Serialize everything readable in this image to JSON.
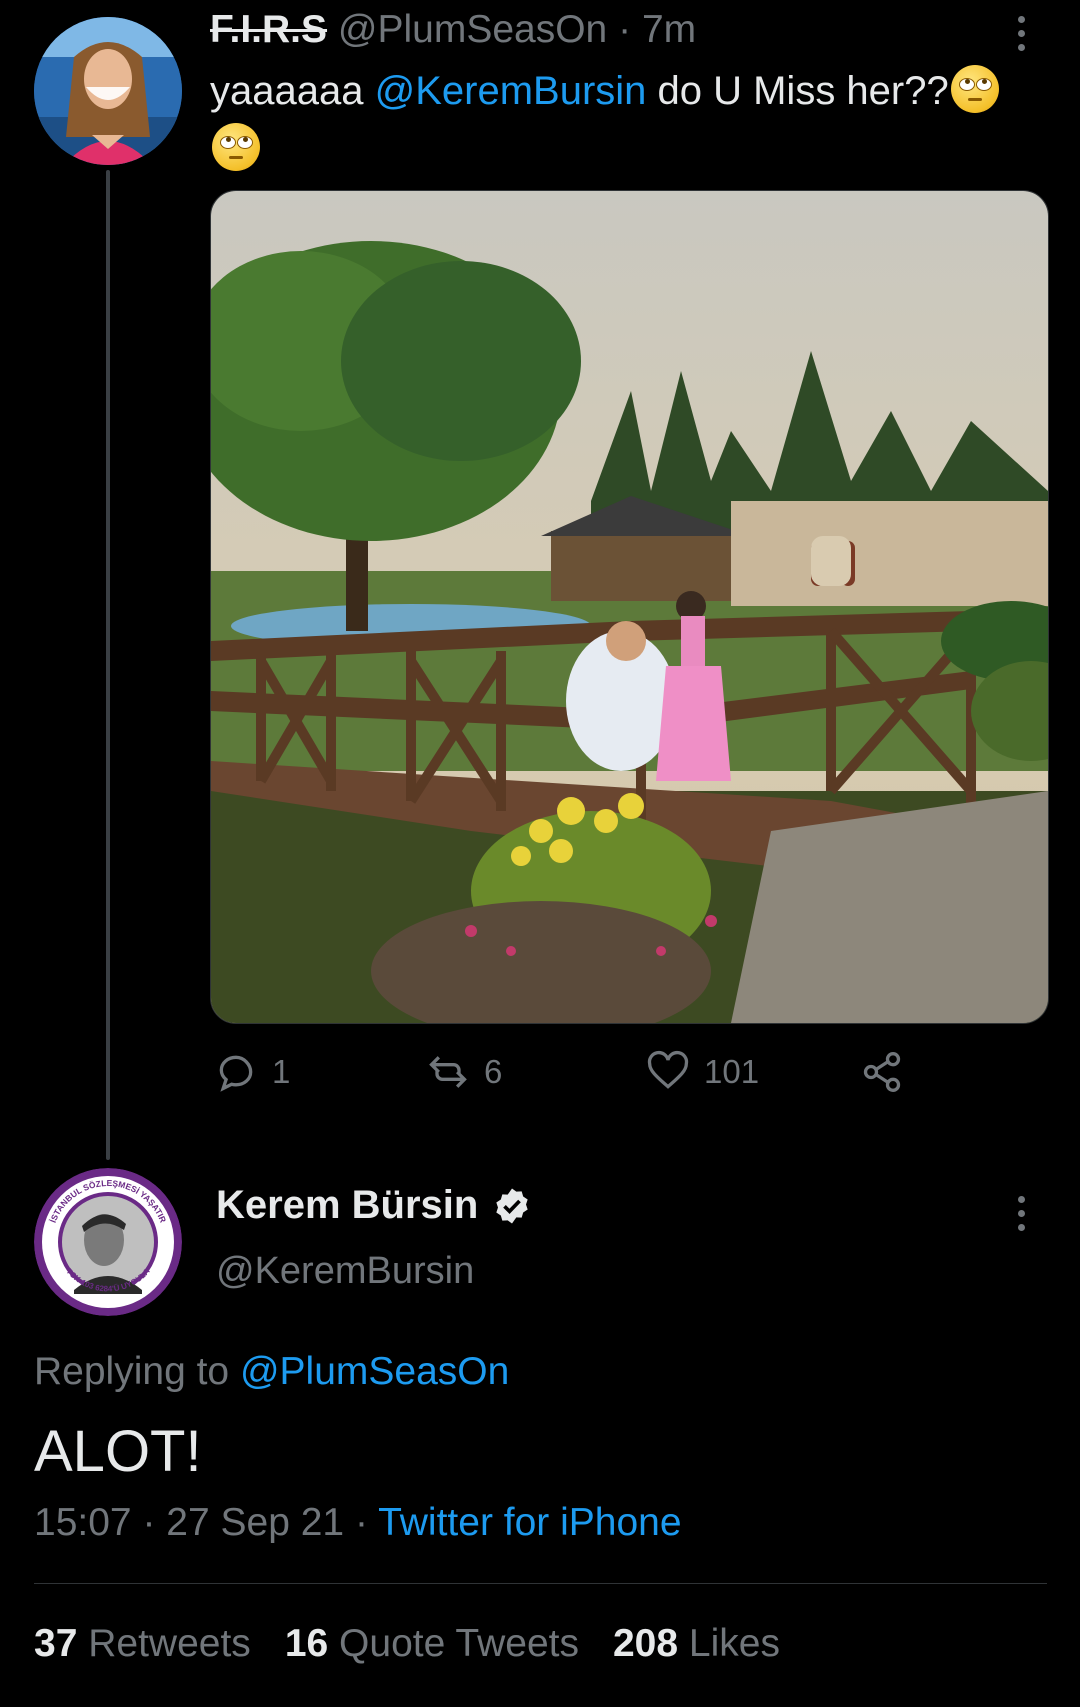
{
  "tweet1": {
    "display_name": "F.I.R.S",
    "handle": "@PlumSeasOn",
    "separator": "·",
    "time": "7m",
    "text_prefix": "yaaaaaa ",
    "mention": "@KeremBursin",
    "text_suffix": " do U Miss her??",
    "emoji_name": "face-with-rolling-eyes",
    "counts": {
      "replies": "1",
      "retweets": "6",
      "likes": "101"
    }
  },
  "tweet2": {
    "display_name": "Kerem Bürsin",
    "handle": "@KeremBursin",
    "avatar_badge_top": "İSTANBUL SÖZLEŞMESİ YAŞATIR",
    "avatar_badge_bottom": "TCK-103 6284'Ü UYGULA",
    "replying_label": "Replying to ",
    "replying_handle": "@PlumSeasOn",
    "text": "ALOT!",
    "time": "15:07",
    "date": "27 Sep 21",
    "source": "Twitter for iPhone",
    "stats": {
      "retweets_count": "37",
      "retweets_label": "Retweets",
      "quotes_count": "16",
      "quotes_label": "Quote Tweets",
      "likes_count": "208",
      "likes_label": "Likes"
    }
  },
  "colors": {
    "background": "#000000",
    "link": "#1d9bf0",
    "muted": "#71767b",
    "text": "#e7e9ea"
  }
}
